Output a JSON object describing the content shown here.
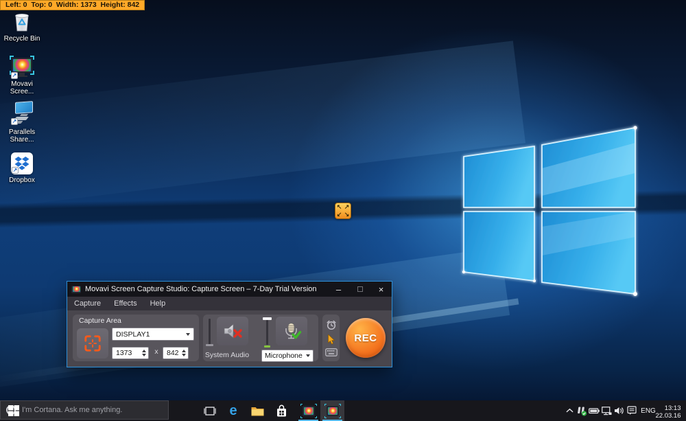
{
  "desktop": {
    "region_info": "Left: 0  Top: 0  Width: 1373  Height: 842",
    "icons": [
      {
        "label": "Recycle Bin"
      },
      {
        "label": "Movavi\nScree..."
      },
      {
        "label": "Parallels\nShare..."
      },
      {
        "label": "Dropbox"
      }
    ],
    "expand_handle": {
      "nw": "↖",
      "ne": "↗",
      "sw": "↙",
      "se": "↘"
    }
  },
  "window": {
    "title": "Movavi Screen Capture Studio: Capture Screen – 7-Day Trial Version",
    "controls": {
      "minimize": "–",
      "close": "×"
    },
    "menu": [
      "Capture",
      "Effects",
      "Help"
    ],
    "capture_area": {
      "label": "Capture Area",
      "display_select": "DISPLAY1",
      "width_value": "1373",
      "separator": "x",
      "height_value": "842"
    },
    "audio": {
      "system_audio_label": "System Audio",
      "microphone_select": "Microphone (I"
    },
    "rec_label": "REC"
  },
  "taskbar": {
    "search_text": "I'm Cortana. Ask me anything.",
    "language": "ENG",
    "time": "13:13",
    "date": "22.03.16",
    "edge_glyph": "e",
    "shortcut_arrow": "↗"
  },
  "colors": {
    "accent_orange": "#f4741f",
    "window_border_blue": "#2e8fd6",
    "region_bar": "#ffa928",
    "taskbar_underline": "#55b8ea"
  }
}
